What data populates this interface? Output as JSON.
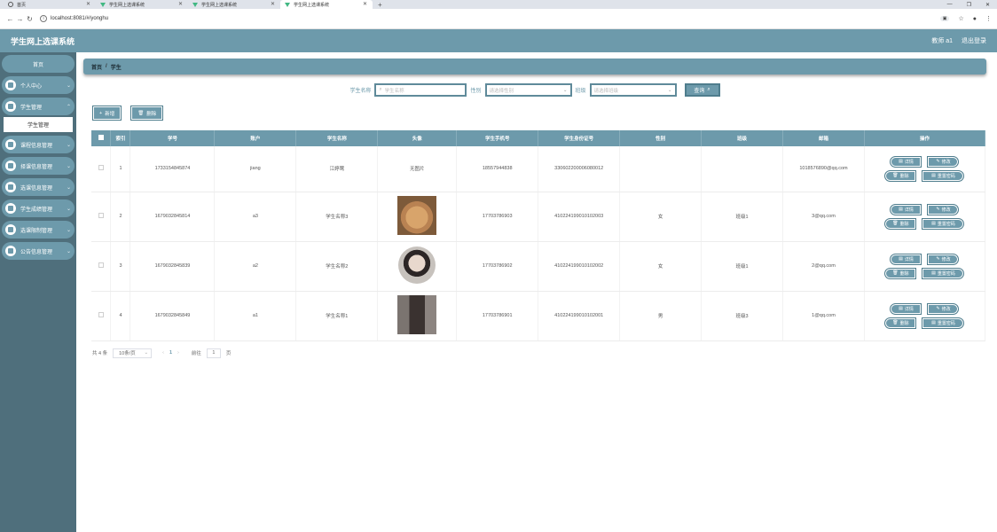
{
  "browser": {
    "tabs": [
      {
        "title": "首页",
        "icon": "globe-icon",
        "active": false
      },
      {
        "title": "学生网上选课系统",
        "icon": "vue-icon",
        "active": false
      },
      {
        "title": "学生网上选课系统",
        "icon": "vue-icon",
        "active": false
      },
      {
        "title": "学生网上选课系统",
        "icon": "vue-icon",
        "active": true
      }
    ],
    "url": "localhost:8081/#/yonghu"
  },
  "header": {
    "title": "学生网上选课系统",
    "user": "教师 a1",
    "logout": "退出登录"
  },
  "sidebar": {
    "home": "首页",
    "items": [
      {
        "label": "个人中心"
      },
      {
        "label": "学生管理",
        "sub": "学生管理"
      },
      {
        "label": "课程信息管理"
      },
      {
        "label": "择课信息管理"
      },
      {
        "label": "选课信息管理"
      },
      {
        "label": "学生成绩管理"
      },
      {
        "label": "选课限制管理"
      },
      {
        "label": "公告信息管理"
      }
    ]
  },
  "breadcrumb": {
    "home": "首页",
    "sep": "/",
    "current": "学生"
  },
  "search": {
    "name_label": "学生名称",
    "name_placeholder": "学生名称",
    "gender_label": "性别",
    "gender_placeholder": "请选择性别",
    "class_label": "班级",
    "class_placeholder": "请选择班级",
    "query_label": "查询"
  },
  "actions": {
    "add": "新增",
    "delete": "删除"
  },
  "table": {
    "headers": [
      "",
      "索引",
      "学号",
      "账户",
      "学生名称",
      "头像",
      "学生手机号",
      "学生身份证号",
      "性别",
      "班级",
      "邮箱",
      "操作"
    ],
    "rows": [
      {
        "index": "1",
        "student_no": "1733154845874",
        "account": "jiang",
        "name": "江婷莺",
        "avatar_text": "无图片",
        "phone": "18557944838",
        "id_card": "330602200006080012",
        "gender": "",
        "class": "",
        "email": "1018576890@qq.com"
      },
      {
        "index": "2",
        "student_no": "1679032845814",
        "account": "a3",
        "name": "学生名称3",
        "avatar_text": "",
        "phone": "17703786903",
        "id_card": "410224199010102003",
        "gender": "女",
        "class": "班级1",
        "email": "3@qq.com"
      },
      {
        "index": "3",
        "student_no": "1679032845839",
        "account": "a2",
        "name": "学生名称2",
        "avatar_text": "",
        "phone": "17703786902",
        "id_card": "410224199010102002",
        "gender": "女",
        "class": "班级1",
        "email": "2@qq.com"
      },
      {
        "index": "4",
        "student_no": "1679032845849",
        "account": "a1",
        "name": "学生名称1",
        "avatar_text": "",
        "phone": "17703786901",
        "id_card": "410224199010102001",
        "gender": "男",
        "class": "班级3",
        "email": "1@qq.com"
      }
    ],
    "ops": {
      "detail": "详情",
      "edit": "修改",
      "delete": "删除",
      "reset": "重置密码"
    }
  },
  "pager": {
    "total": "共 4 条",
    "page_size": "10条/页",
    "current_page": "1",
    "goto_label": "前往",
    "goto_value": "1",
    "page_unit": "页"
  },
  "colors": {
    "primary": "#6d9aab",
    "sidebar": "#4f6f7c"
  }
}
